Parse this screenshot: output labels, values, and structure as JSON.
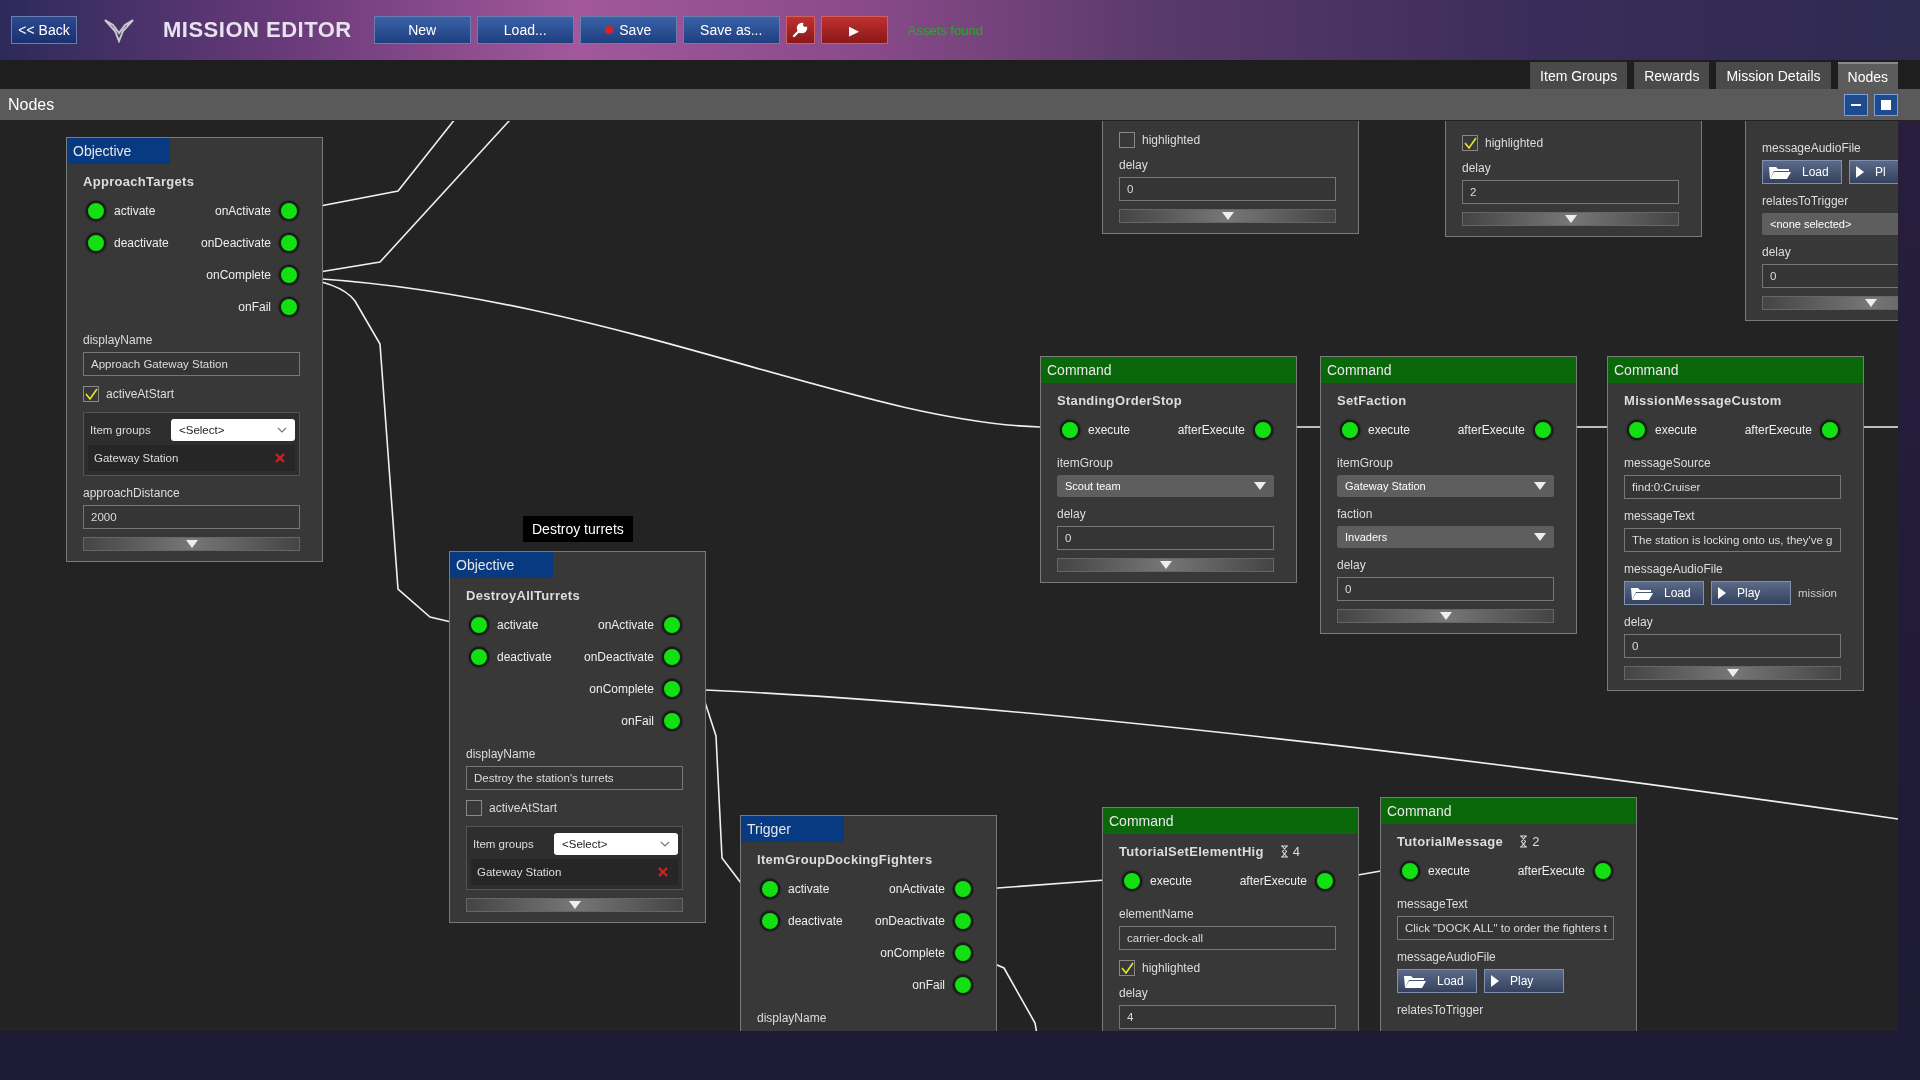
{
  "top_bar": {
    "back": "<< Back",
    "title": "MISSION EDITOR",
    "status": "Assets found",
    "toolbar": [
      {
        "kind": "text",
        "label": "New"
      },
      {
        "kind": "text",
        "label": "Load..."
      },
      {
        "kind": "save",
        "label": "Save"
      },
      {
        "kind": "text",
        "label": "Save as..."
      },
      {
        "kind": "wrench"
      },
      {
        "kind": "play",
        "label": "▶"
      }
    ]
  },
  "tabs": [
    {
      "label": "Item Groups",
      "selected": false
    },
    {
      "label": "Rewards",
      "selected": false
    },
    {
      "label": "Mission Details",
      "selected": false
    },
    {
      "label": "Nodes",
      "selected": true
    }
  ],
  "panel": {
    "title": "Nodes"
  },
  "nodes": [
    {
      "kind": "objective",
      "header": "Objective",
      "name": "ApproachTargets",
      "ports": [
        {
          "in": "activate",
          "out": "onActivate"
        },
        {
          "in": "deactivate",
          "out": "onDeactivate"
        },
        {
          "out": "onComplete"
        },
        {
          "out": "onFail"
        }
      ],
      "fields": [
        {
          "kind": "text",
          "label": "displayName",
          "value": "Approach Gateway Station"
        },
        {
          "kind": "checkbox",
          "label": "activeAtStart",
          "checked": true
        },
        {
          "kind": "item_groups",
          "label": "Item groups",
          "value": "<Select>",
          "items": [
            "Gateway Station"
          ]
        },
        {
          "kind": "text",
          "label": "approachDistance",
          "value": "2000"
        }
      ],
      "expander": true
    },
    {
      "kind": "objective",
      "header": "Objective",
      "tooltip": "Destroy turrets",
      "name": "DestroyAllTurrets",
      "ports": [
        {
          "in": "activate",
          "out": "onActivate"
        },
        {
          "in": "deactivate",
          "out": "onDeactivate"
        },
        {
          "out": "onComplete"
        },
        {
          "out": "onFail"
        }
      ],
      "fields": [
        {
          "kind": "text",
          "label": "displayName",
          "value": "Destroy the station's turrets"
        },
        {
          "kind": "checkbox",
          "label": "activeAtStart",
          "checked": false
        },
        {
          "kind": "item_groups",
          "label": "Item groups",
          "value": "<Select>",
          "items": [
            "Gateway Station"
          ]
        }
      ],
      "expander": true
    },
    {
      "kind": "trigger",
      "header": "Trigger",
      "name": "ItemGroupDockingFighters",
      "ports": [
        {
          "in": "activate",
          "out": "onActivate"
        },
        {
          "in": "deactivate",
          "out": "onDeactivate"
        },
        {
          "out": "onComplete"
        },
        {
          "out": "onFail"
        }
      ],
      "fields": [
        {
          "kind": "label",
          "label": "displayName"
        }
      ]
    },
    {
      "kind": "command",
      "header": "Command",
      "name": "TutorialSetElementHig",
      "badge": "4",
      "ports": [
        {
          "in": "execute",
          "out": "afterExecute"
        }
      ],
      "fields": [
        {
          "kind": "text",
          "label": "elementName",
          "value": "carrier-dock-all"
        },
        {
          "kind": "checkbox",
          "label": "highlighted",
          "checked": true
        },
        {
          "kind": "text",
          "label": "delay",
          "value": "4"
        }
      ]
    },
    {
      "kind": "command",
      "header": "Command",
      "name": "TutorialMessage",
      "badge": "2",
      "ports": [
        {
          "in": "execute",
          "out": "afterExecute"
        }
      ],
      "fields": [
        {
          "kind": "text",
          "label": "messageText",
          "value": "Click \"DOCK ALL\" to order the fighters t"
        },
        {
          "kind": "audio",
          "label": "messageAudioFile",
          "buttons": [
            "Load",
            "Play"
          ]
        },
        {
          "kind": "label",
          "label": "relatesToTrigger"
        }
      ]
    },
    {
      "kind": "command",
      "header": "Command",
      "name": "StandingOrderStop",
      "ports": [
        {
          "in": "execute",
          "out": "afterExecute"
        }
      ],
      "fields": [
        {
          "kind": "select",
          "label": "itemGroup",
          "value": "Scout team"
        },
        {
          "kind": "text",
          "label": "delay",
          "value": "0"
        }
      ],
      "expander": true
    },
    {
      "kind": "command",
      "header": "Command",
      "name": "SetFaction",
      "ports": [
        {
          "in": "execute",
          "out": "afterExecute"
        }
      ],
      "fields": [
        {
          "kind": "select",
          "label": "itemGroup",
          "value": "Gateway Station"
        },
        {
          "kind": "select",
          "label": "faction",
          "value": "Invaders"
        },
        {
          "kind": "text",
          "label": "delay",
          "value": "0"
        }
      ],
      "expander": true
    },
    {
      "kind": "command",
      "header": "Command",
      "name": "MissionMessageCustom",
      "ports": [
        {
          "in": "execute",
          "out": "afterExecute"
        }
      ],
      "fields": [
        {
          "kind": "text",
          "label": "messageSource",
          "value": "find:0:Cruiser"
        },
        {
          "kind": "text",
          "label": "messageText",
          "value": "The station is locking onto us, they've g"
        },
        {
          "kind": "audio",
          "label": "messageAudioFile",
          "buttons": [
            "Load",
            "Play"
          ],
          "note": "mission"
        },
        {
          "kind": "text",
          "label": "delay",
          "value": "0"
        }
      ],
      "expander": true
    },
    {
      "fields": [
        {
          "kind": "checkbox",
          "label": "highlighted",
          "checked": false
        },
        {
          "kind": "text",
          "label": "delay",
          "value": "0"
        }
      ],
      "expander": true
    },
    {
      "fields": [
        {
          "kind": "checkbox",
          "label": "highlighted",
          "checked": true
        },
        {
          "kind": "text",
          "label": "delay",
          "value": "2"
        }
      ],
      "expander": true
    },
    {
      "fields": [
        {
          "kind": "audio",
          "label": "messageAudioFile",
          "buttons": [
            "Load",
            "Pl"
          ]
        },
        {
          "kind": "select",
          "label": "relatesToTrigger",
          "value": "<none selected>"
        },
        {
          "kind": "text",
          "label": "delay",
          "value": "0"
        }
      ],
      "expander": true
    }
  ]
}
